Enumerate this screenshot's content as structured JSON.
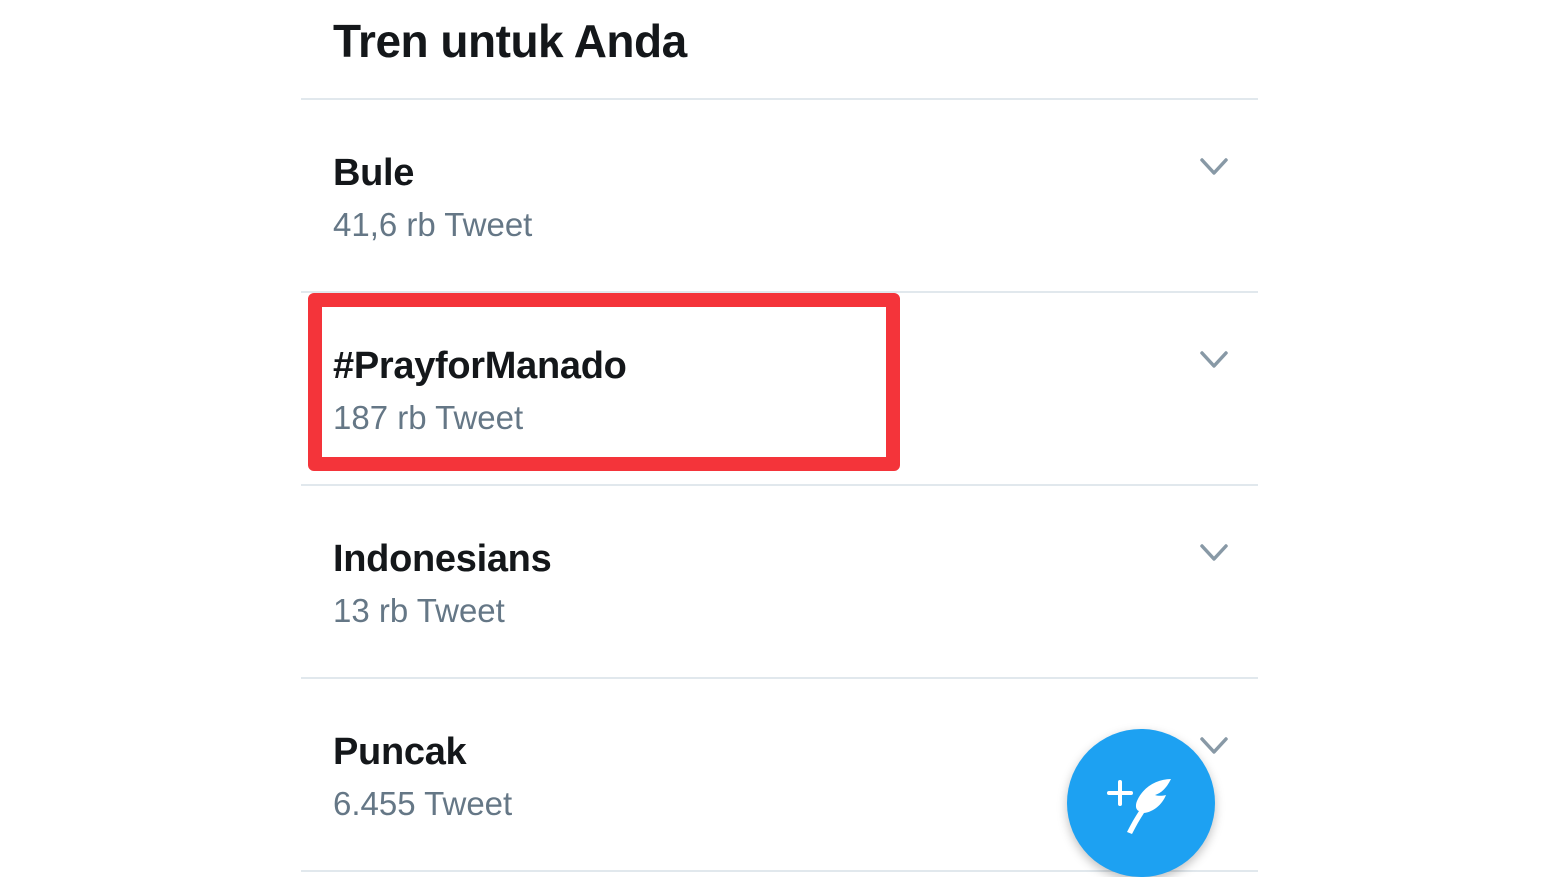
{
  "header": {
    "title": "Tren untuk Anda"
  },
  "trends": [
    {
      "name": "Bule",
      "count": "41,6 rb Tweet",
      "icon": "chevron-down-icon"
    },
    {
      "name": "#PrayforManado",
      "count": "187 rb Tweet",
      "icon": "chevron-down-icon",
      "highlighted": true
    },
    {
      "name": "Indonesians",
      "count": "13 rb Tweet",
      "icon": "chevron-down-icon"
    },
    {
      "name": "Puncak",
      "count": "6.455 Tweet",
      "icon": "chevron-down-icon"
    }
  ],
  "compose_button": {
    "icon": "compose-tweet-icon"
  },
  "colors": {
    "accent": "#1da1f2",
    "highlight": "#f4343a",
    "text_primary": "#14171a",
    "text_secondary": "#657786",
    "divider": "#e1e8ed"
  }
}
